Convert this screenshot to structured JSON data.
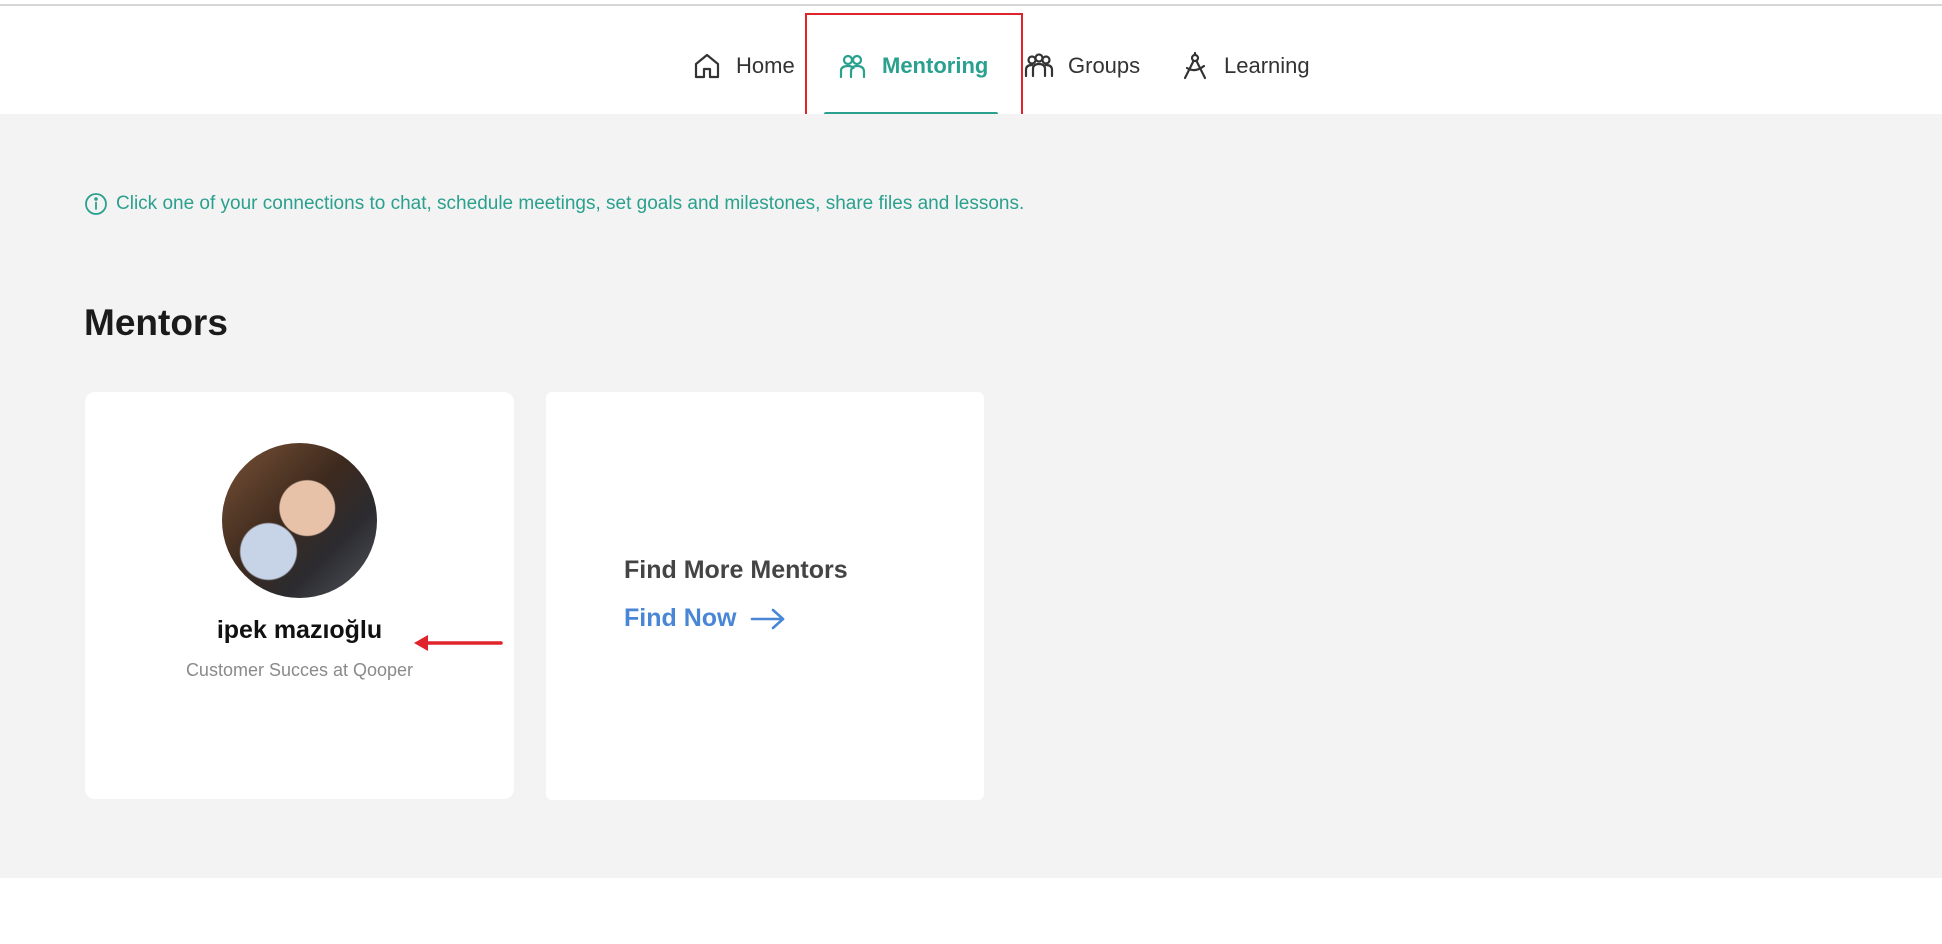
{
  "nav": {
    "items": [
      {
        "label": "Home",
        "icon": "home-icon",
        "active": false
      },
      {
        "label": "Mentoring",
        "icon": "mentoring-icon",
        "active": true
      },
      {
        "label": "Groups",
        "icon": "groups-icon",
        "active": false
      },
      {
        "label": "Learning",
        "icon": "learning-icon",
        "active": false
      }
    ]
  },
  "info": {
    "text": "Click one of your connections to chat, schedule meetings, set goals and milestones, share files and lessons."
  },
  "mentors": {
    "title": "Mentors",
    "items": [
      {
        "name": "ipek mazıoğlu",
        "role": "Customer Succes at Qooper"
      }
    ],
    "find_more": {
      "title": "Find More Mentors",
      "link_label": "Find Now"
    }
  },
  "colors": {
    "accent": "#2aa08e",
    "link": "#4a86d6",
    "annotation": "#e0242b",
    "background": "#f3f3f3"
  }
}
